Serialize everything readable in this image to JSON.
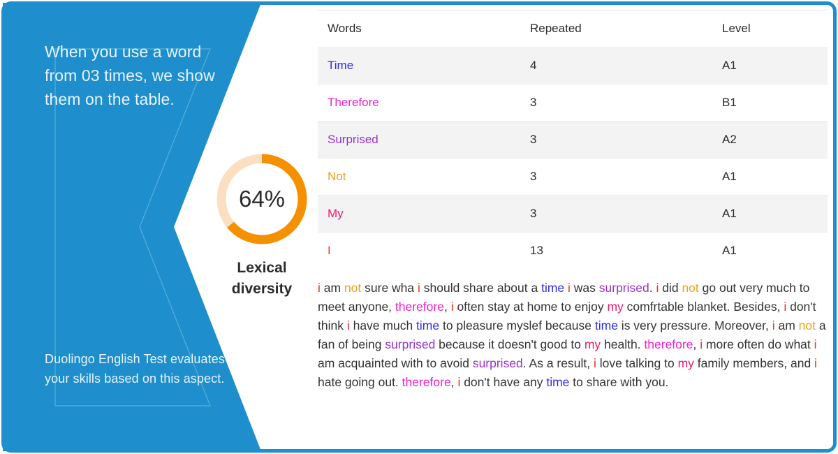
{
  "frame": {
    "border_color": "#1E8FCC",
    "background": "#ffffff"
  },
  "left_panel": {
    "background_color": "#1E8FCC",
    "shadow_color": "#1478B0",
    "inner_frame_color": "#63B5DD",
    "top_text": "When you use a word from 03 times, we show them on the table.",
    "bottom_text": "Duolingo English Test evaluates your skills based on this aspect."
  },
  "donut": {
    "percent_label": "64%",
    "value": 64,
    "max": 100,
    "title": "Lexical diversity",
    "arc_color": "#F59100",
    "track_color": "#FBDFC0"
  },
  "table": {
    "columns": [
      "Words",
      "Repeated",
      "Level"
    ],
    "rows": [
      {
        "word": "Time",
        "color": "#2E2EE8",
        "repeated": "4",
        "level": "A1"
      },
      {
        "word": "Therefore",
        "color": "#F020D0",
        "repeated": "3",
        "level": "B1"
      },
      {
        "word": "Surprised",
        "color": "#9932CC",
        "repeated": "3",
        "level": "A2"
      },
      {
        "word": "Not",
        "color": "#F0A020",
        "repeated": "3",
        "level": "A1"
      },
      {
        "word": "My",
        "color": "#F0186C",
        "repeated": "3",
        "level": "A1"
      },
      {
        "word": "I",
        "color": "#EE3322",
        "repeated": "13",
        "level": "A1"
      }
    ]
  },
  "paragraph": {
    "base_color": "#333333",
    "tokens": [
      {
        "t": "i",
        "c": "#EE3322"
      },
      {
        "t": " am "
      },
      {
        "t": "not",
        "c": "#F0A020"
      },
      {
        "t": " sure wha "
      },
      {
        "t": "i",
        "c": "#EE3322"
      },
      {
        "t": " should share about a "
      },
      {
        "t": "time",
        "c": "#2E2EE8"
      },
      {
        "t": " "
      },
      {
        "t": "i",
        "c": "#EE3322"
      },
      {
        "t": " was "
      },
      {
        "t": "surprised",
        "c": "#9932CC"
      },
      {
        "t": ". "
      },
      {
        "t": "i",
        "c": "#EE3322"
      },
      {
        "t": " did "
      },
      {
        "t": "not",
        "c": "#F0A020"
      },
      {
        "t": " go out very much to meet anyone, "
      },
      {
        "t": "therefore",
        "c": "#F020D0"
      },
      {
        "t": ", "
      },
      {
        "t": "i",
        "c": "#EE3322"
      },
      {
        "t": " often stay at home to enjoy "
      },
      {
        "t": "my",
        "c": "#F0186C"
      },
      {
        "t": " comfrtable blanket. Besides, "
      },
      {
        "t": "i",
        "c": "#EE3322"
      },
      {
        "t": " don't think "
      },
      {
        "t": "i",
        "c": "#EE3322"
      },
      {
        "t": " have much "
      },
      {
        "t": "time",
        "c": "#2E2EE8"
      },
      {
        "t": " to pleasure myslef because "
      },
      {
        "t": "time",
        "c": "#2E2EE8"
      },
      {
        "t": " is very pressure. Moreover, "
      },
      {
        "t": "i",
        "c": "#EE3322"
      },
      {
        "t": " am "
      },
      {
        "t": "not",
        "c": "#F0A020"
      },
      {
        "t": " a fan of being "
      },
      {
        "t": "surprised",
        "c": "#9932CC"
      },
      {
        "t": " because it doesn't good to "
      },
      {
        "t": "my",
        "c": "#F0186C"
      },
      {
        "t": " health. "
      },
      {
        "t": "therefore",
        "c": "#F020D0"
      },
      {
        "t": ", "
      },
      {
        "t": "i",
        "c": "#EE3322"
      },
      {
        "t": " more often do what "
      },
      {
        "t": "i",
        "c": "#EE3322"
      },
      {
        "t": " am acquainted with to avoid "
      },
      {
        "t": "surprised",
        "c": "#9932CC"
      },
      {
        "t": ". As a result, "
      },
      {
        "t": "i",
        "c": "#EE3322"
      },
      {
        "t": " love talking to "
      },
      {
        "t": "my",
        "c": "#F0186C"
      },
      {
        "t": " family members, and "
      },
      {
        "t": "i",
        "c": "#EE3322"
      },
      {
        "t": " hate going out. "
      },
      {
        "t": "therefore",
        "c": "#F020D0"
      },
      {
        "t": ", "
      },
      {
        "t": "i",
        "c": "#EE3322"
      },
      {
        "t": " don't have any "
      },
      {
        "t": "time",
        "c": "#2E2EE8"
      },
      {
        "t": " to share with you."
      }
    ]
  }
}
